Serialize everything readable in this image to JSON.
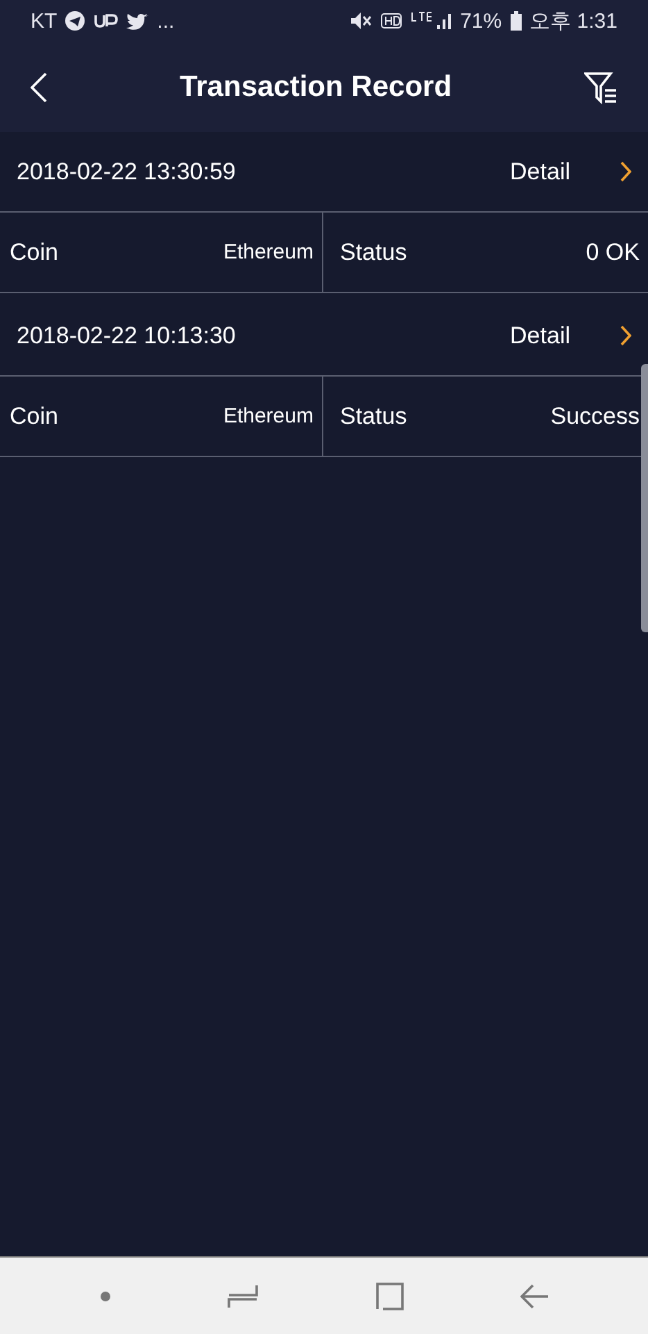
{
  "status_bar": {
    "carrier": "KT",
    "more": "...",
    "battery": "71%",
    "time": "오후 1:31"
  },
  "header": {
    "title": "Transaction Record"
  },
  "records": [
    {
      "datetime": "2018-02-22 13:30:59",
      "detail": "Detail",
      "coin_label": "Coin",
      "coin": "Ethereum",
      "status_label": "Status",
      "status": "0 OK"
    },
    {
      "datetime": "2018-02-22 10:13:30",
      "detail": "Detail",
      "coin_label": "Coin",
      "coin": "Ethereum",
      "status_label": "Status",
      "status": "Success"
    }
  ]
}
